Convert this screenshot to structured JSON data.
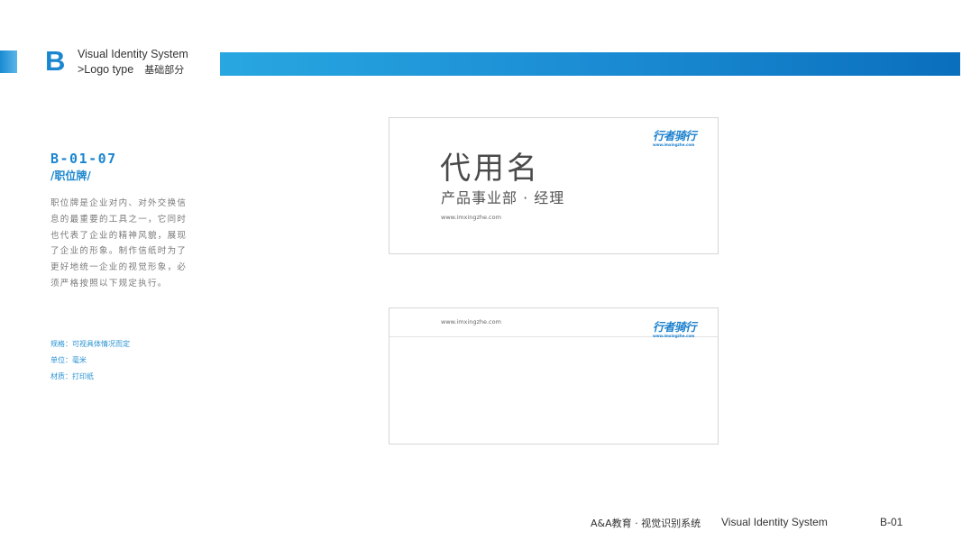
{
  "header": {
    "section_letter": "B",
    "line1": "Visual Identity System",
    "line2_en": ">Logo type",
    "line2_cn": "基础部分",
    "accent_color": "#1a86cf"
  },
  "sidebar": {
    "code": "B-01-07",
    "subtitle": "/职位牌/",
    "description": "职位牌是企业对内、对外交换信息的最重要的工具之一，它同时也代表了企业的精神风貌，展现了企业的形象。制作信纸时为了更好地统一企业的视觉形象，必须严格按照以下规定执行。",
    "specs": [
      "规格：可视具体情况而定",
      "单位：毫米",
      "材质：打印纸"
    ]
  },
  "card_front": {
    "name": "代用名",
    "title": "产品事业部 · 经理",
    "url": "www.imxingzhe.com",
    "logo_cn": "行者骑行",
    "logo_en": "www.imxingzhe.com"
  },
  "card_back": {
    "url": "www.imxingzhe.com",
    "logo_cn": "行者骑行",
    "logo_en": "www.imxingzhe.com"
  },
  "footer": {
    "cn": "A&A教育 · 视觉识别系统",
    "en": "Visual Identity System",
    "page": "B-01"
  }
}
